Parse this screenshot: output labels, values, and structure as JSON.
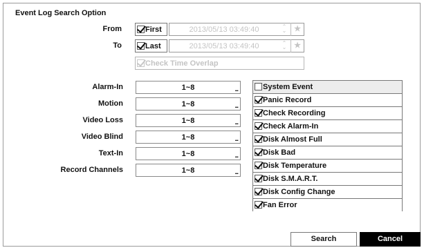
{
  "dialog": {
    "title": "Event Log Search Option",
    "from": {
      "label": "From",
      "option": "First",
      "checked": true,
      "datetime": "2013/05/13  03:49:40"
    },
    "to": {
      "label": "To",
      "option": "Last",
      "checked": true,
      "datetime": "2013/05/13  03:49:40"
    },
    "overlap": {
      "label": "Check Time Overlap",
      "checked": true,
      "disabled": true
    },
    "filters": [
      {
        "label": "Alarm-In",
        "value": "1~8"
      },
      {
        "label": "Motion",
        "value": "1~8"
      },
      {
        "label": "Video Loss",
        "value": "1~8"
      },
      {
        "label": "Video Blind",
        "value": "1~8"
      },
      {
        "label": "Text-In",
        "value": "1~8"
      },
      {
        "label": "Record Channels",
        "value": "1~8"
      }
    ],
    "ellipsis": "...",
    "system_events": {
      "header": {
        "label": "System Event",
        "checked": false
      },
      "items": [
        {
          "label": "Panic Record",
          "checked": true
        },
        {
          "label": "Check Recording",
          "checked": true
        },
        {
          "label": "Check Alarm-In",
          "checked": true
        },
        {
          "label": "Disk Almost Full",
          "checked": true
        },
        {
          "label": "Disk Bad",
          "checked": true
        },
        {
          "label": "Disk Temperature",
          "checked": true
        },
        {
          "label": "Disk S.M.A.R.T.",
          "checked": true
        },
        {
          "label": "Disk Config Change",
          "checked": true
        },
        {
          "label": "Fan Error",
          "checked": true
        }
      ]
    },
    "buttons": {
      "search": "Search",
      "cancel": "Cancel"
    }
  }
}
